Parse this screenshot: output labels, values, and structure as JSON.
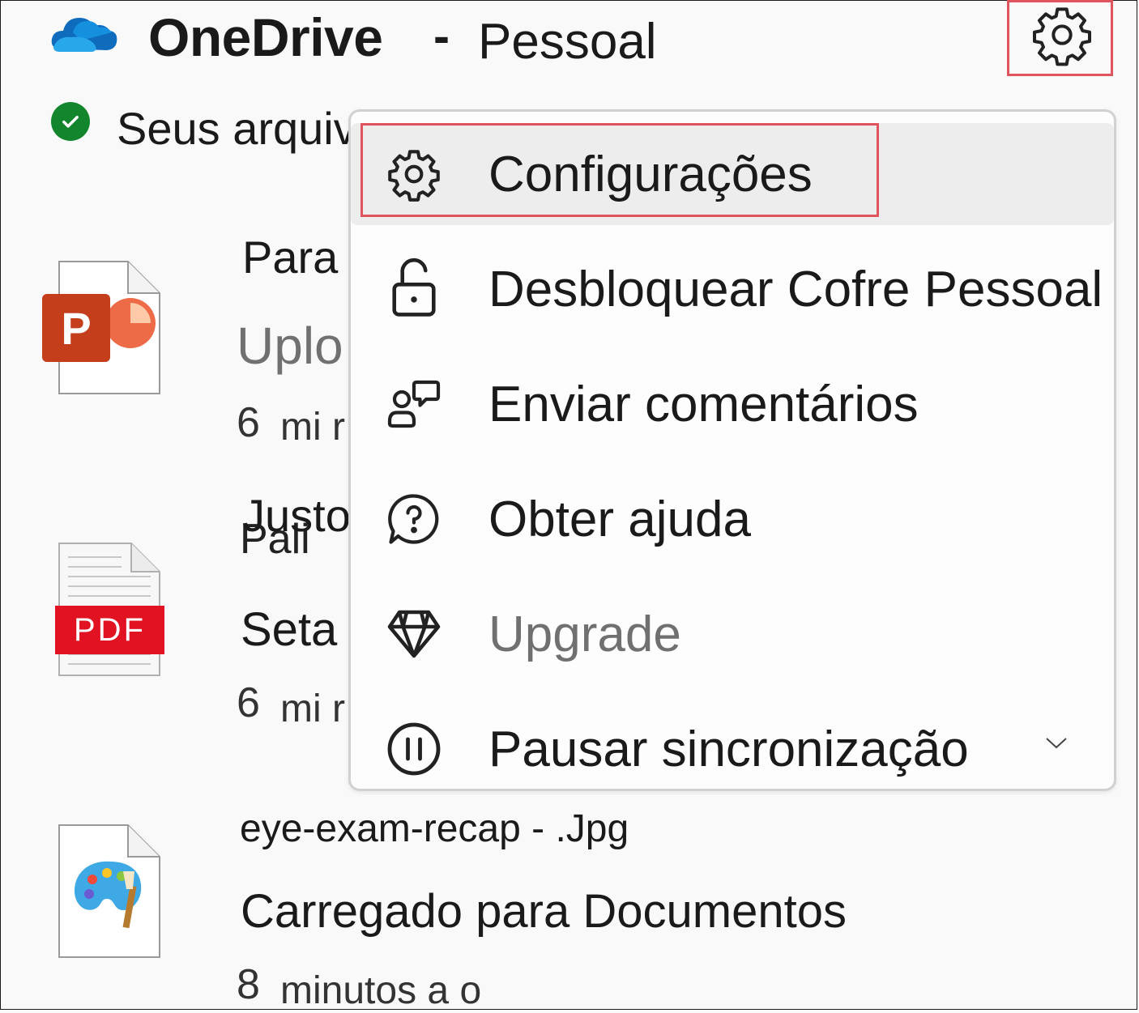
{
  "header": {
    "app_name": "OneDrive",
    "separator": "-",
    "account": "Pessoal"
  },
  "status": {
    "text": "Seus arquivos"
  },
  "files": [
    {
      "name": "Para",
      "meta": "Uplo",
      "time_num": "6",
      "time_unit": "mi r",
      "icon": "powerpoint-icon"
    },
    {
      "name": "Justo",
      "subname": "Pali",
      "meta": "Seta para cima",
      "time_num": "6",
      "time_unit": "mi r",
      "icon": "pdf-icon",
      "badge": "PDF"
    },
    {
      "name": "eye-exam-recap - .Jpg",
      "meta": "Carregado para Documentos",
      "time_num": "8",
      "time_unit": "minutos a o",
      "icon": "paint-image-icon"
    }
  ],
  "menu": {
    "items": [
      {
        "label": "Configurações",
        "icon": "gear-icon"
      },
      {
        "label": "Desbloquear Cofre Pessoal",
        "icon": "unlock-icon"
      },
      {
        "label": "Enviar comentários",
        "icon": "feedback-icon"
      },
      {
        "label": "Obter ajuda",
        "icon": "help-icon"
      },
      {
        "label": "Upgrade",
        "icon": "diamond-icon"
      },
      {
        "label": "Pausar sincronização",
        "icon": "pause-icon"
      }
    ]
  },
  "colors": {
    "highlight": "#e0545e",
    "status_green": "#13862d",
    "pdf_red": "#e11221",
    "ppt_orange": "#c43e1c"
  }
}
